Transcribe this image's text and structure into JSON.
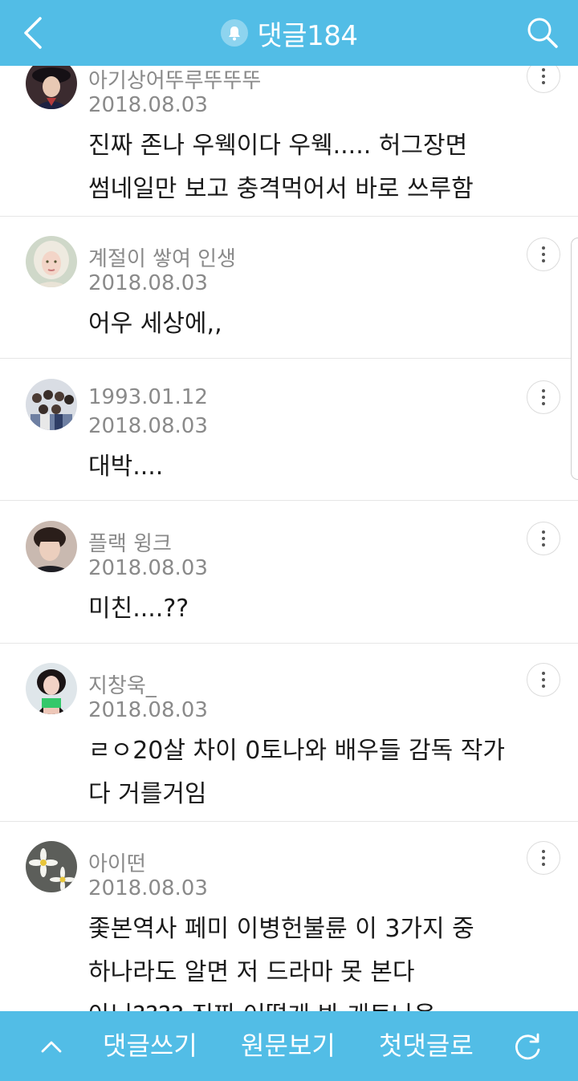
{
  "header": {
    "title": "댓글184",
    "icons": {
      "back": "chevron-left-icon",
      "bell": "bell-icon",
      "search": "search-icon"
    }
  },
  "comments": [
    {
      "nickname": "아기상어뚜루뚜뚜뚜",
      "date": "2018.08.03",
      "lines": [
        "진짜 존나 우웩이다 우웩..... 허그장면",
        "썸네일만 보고 충격먹어서 바로 쓰루함"
      ]
    },
    {
      "nickname": "계절이 쌓여 인생",
      "date": "2018.08.03",
      "lines": [
        "어우 세상에,,"
      ]
    },
    {
      "nickname": "1993.01.12",
      "date": "2018.08.03",
      "lines": [
        "대박...."
      ]
    },
    {
      "nickname": "플랙 윙크",
      "date": "2018.08.03",
      "lines": [
        "미친....??"
      ]
    },
    {
      "nickname": "지창욱_",
      "date": "2018.08.03",
      "lines": [
        "ㄹㅇ20살 차이 0토나와 배우들 감독 작가",
        "다 거를거임"
      ]
    },
    {
      "nickname": "아이떤",
      "date": "2018.08.03",
      "lines": [
        "좇본역사 페미 이병헌불륜 이 3가지 중",
        "하나라도 알면 저 드라마 못 본다",
        "아님???? 진짜 어떻게 봐 개토나옴"
      ]
    }
  ],
  "bottom_bar": {
    "write": "댓글쓰기",
    "original": "원문보기",
    "first": "첫댓글로",
    "icons": {
      "up": "chevron-up-icon",
      "refresh": "refresh-icon"
    }
  },
  "colors": {
    "accent": "#52bde6",
    "meta_text": "#8a8a8a",
    "body_text": "#1a1a1a",
    "divider": "#e6e6e6"
  }
}
